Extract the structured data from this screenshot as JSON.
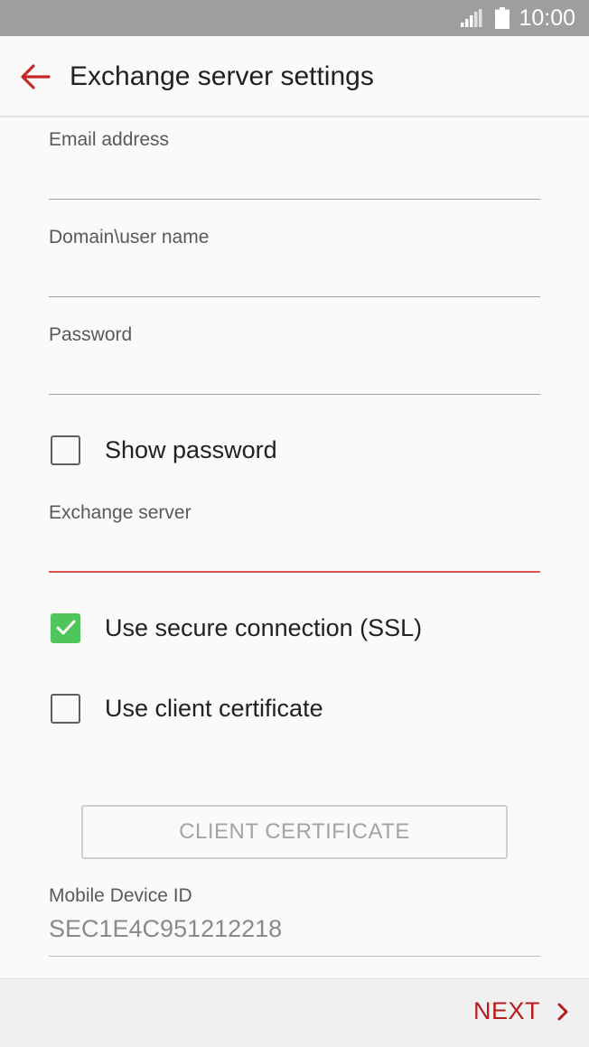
{
  "status_bar": {
    "time": "10:00",
    "icons": [
      "signal-icon",
      "battery-icon"
    ]
  },
  "app_bar": {
    "back_icon": "arrow-left-icon",
    "title": "Exchange server settings",
    "accent_color": "#c62828"
  },
  "form": {
    "email": {
      "label": "Email address",
      "value": ""
    },
    "username": {
      "label": "Domain\\user name",
      "value": ""
    },
    "password": {
      "label": "Password",
      "value": ""
    },
    "show_password": {
      "label": "Show password",
      "checked": false
    },
    "exchange_server": {
      "label": "Exchange server",
      "value": "",
      "focused": true
    },
    "use_ssl": {
      "label": "Use secure connection (SSL)",
      "checked": true
    },
    "use_client_certificate": {
      "label": "Use client certificate",
      "checked": false
    },
    "client_certificate_button": {
      "label": "CLIENT CERTIFICATE",
      "enabled": false
    },
    "mobile_device_id": {
      "label": "Mobile Device ID",
      "value": "SEC1E4C951212218"
    }
  },
  "footer": {
    "next_label": "NEXT",
    "next_icon": "chevron-right-icon"
  },
  "colors": {
    "status_bar": "#9e9e9e",
    "checkbox_checked": "#4fc65b",
    "focused_underline": "#e0534e",
    "next_text": "#b71c1c"
  }
}
